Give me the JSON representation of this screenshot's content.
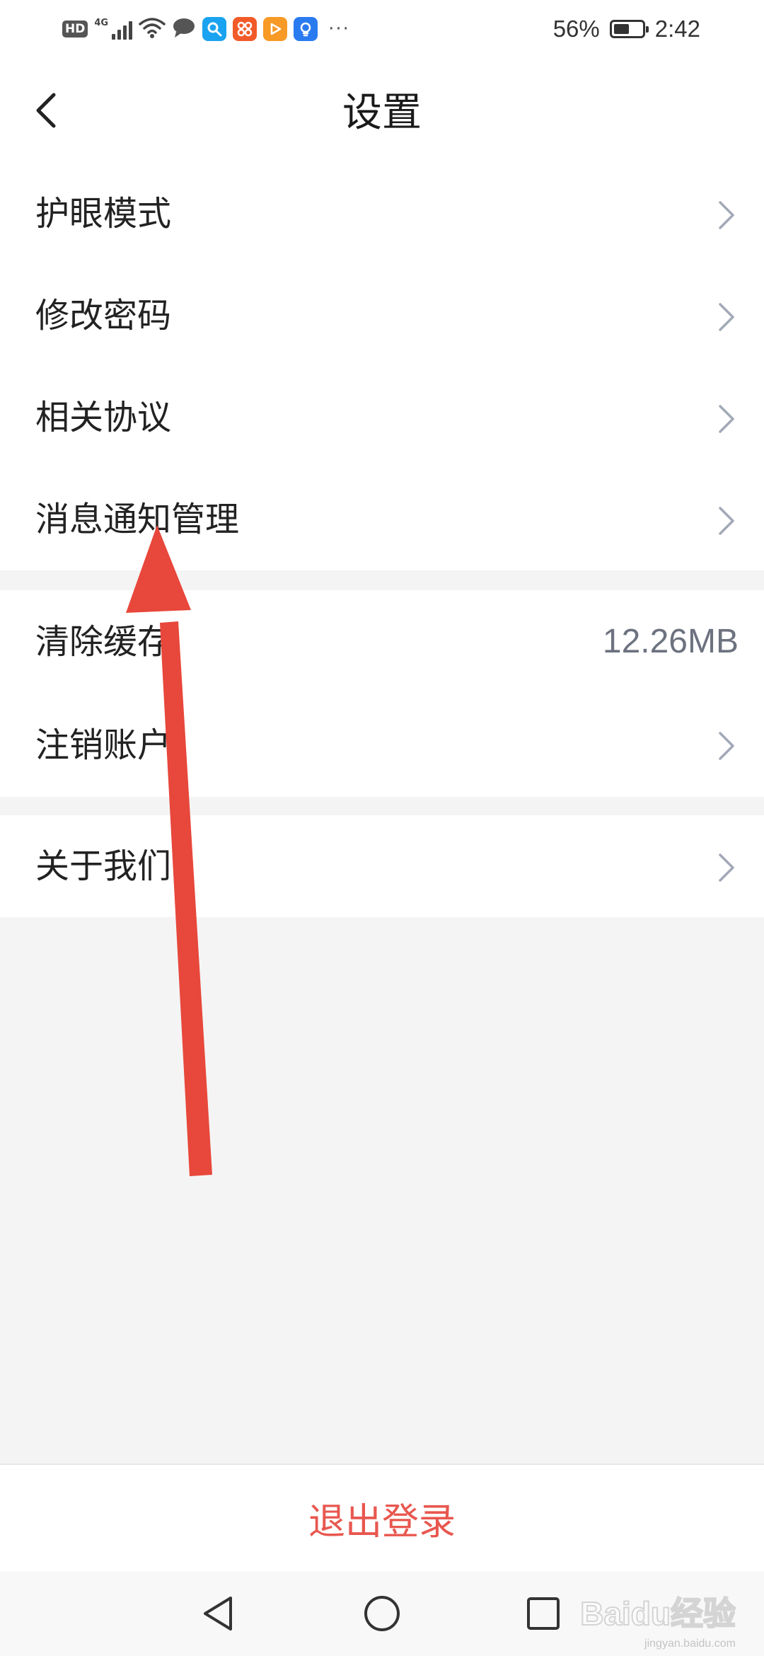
{
  "status_bar": {
    "hd": "HD",
    "network": "4G",
    "battery_percent": "56%",
    "battery_level": 0.56,
    "time": "2:42",
    "more": "···",
    "icons": [
      "signal-icon",
      "wifi-icon",
      "chat-bubble-icon",
      "search-app-icon",
      "grid-app-icon",
      "play-app-icon",
      "bulb-app-icon"
    ]
  },
  "header": {
    "title": "设置"
  },
  "groups": [
    {
      "items": [
        {
          "label": "护眼模式"
        },
        {
          "label": "修改密码"
        },
        {
          "label": "相关协议"
        },
        {
          "label": "消息通知管理"
        }
      ]
    },
    {
      "items": [
        {
          "label": "清除缓存",
          "value": "12.26MB"
        },
        {
          "label": "注销账户"
        }
      ]
    },
    {
      "items": [
        {
          "label": "关于我们"
        }
      ]
    }
  ],
  "logout": {
    "label": "退出登录"
  },
  "colors": {
    "accent_red": "#e8574f",
    "annotation_arrow": "#e8473b",
    "value_gray": "#6d7280",
    "chevron": "#a3a8b8",
    "background": "#f4f4f4"
  },
  "watermark": {
    "text": "Baidu经验",
    "sub": "jingyan.baidu.com"
  }
}
